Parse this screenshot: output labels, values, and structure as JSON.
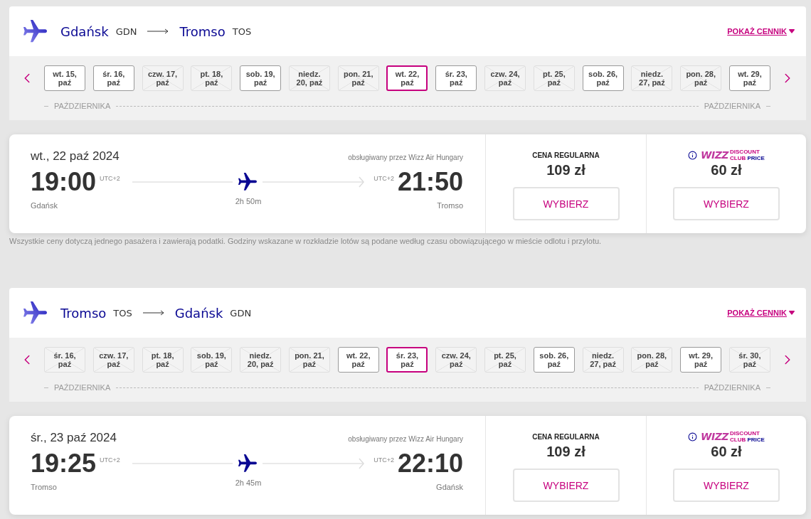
{
  "legs": [
    {
      "route": {
        "origin": {
          "city": "Gdańsk",
          "code": "GDN"
        },
        "destination": {
          "city": "Tromso",
          "code": "TOS"
        }
      },
      "price_link": {
        "label": "POKAŻ CENNIK"
      },
      "date_strip": {
        "dates": [
          {
            "line_1": "wt. 15,",
            "line_2": "paź",
            "available": true,
            "selected": false
          },
          {
            "line_1": "śr. 16,",
            "line_2": "paź",
            "available": true,
            "selected": false
          },
          {
            "line_1": "czw. 17,",
            "line_2": "paź",
            "available": false,
            "selected": false
          },
          {
            "line_1": "pt. 18,",
            "line_2": "paź",
            "available": false,
            "selected": false
          },
          {
            "line_1": "sob. 19,",
            "line_2": "paź",
            "available": true,
            "selected": false
          },
          {
            "line_1": "niedz.",
            "line_2": "20, paź",
            "available": false,
            "selected": false
          },
          {
            "line_1": "pon. 21,",
            "line_2": "paź",
            "available": false,
            "selected": false
          },
          {
            "line_1": "wt. 22,",
            "line_2": "paź",
            "available": true,
            "selected": true
          },
          {
            "line_1": "śr. 23,",
            "line_2": "paź",
            "available": true,
            "selected": false
          },
          {
            "line_1": "czw. 24,",
            "line_2": "paź",
            "available": false,
            "selected": false
          },
          {
            "line_1": "pt. 25,",
            "line_2": "paź",
            "available": false,
            "selected": false
          },
          {
            "line_1": "sob. 26,",
            "line_2": "paź",
            "available": true,
            "selected": false
          },
          {
            "line_1": "niedz.",
            "line_2": "27, paź",
            "available": false,
            "selected": false
          },
          {
            "line_1": "pon. 28,",
            "line_2": "paź",
            "available": false,
            "selected": false
          },
          {
            "line_1": "wt. 29,",
            "line_2": "paź",
            "available": true,
            "selected": false
          }
        ],
        "month_labels": [
          "PAŹDZIERNIKA",
          "PAŹDZIERNIKA"
        ]
      },
      "flight": {
        "date": "wt., 22 paź 2024",
        "operator": "obsługiwany przez Wizz Air Hungary",
        "departure": {
          "time": "19:00",
          "timezone": "UTC+2",
          "city": "Gdańsk"
        },
        "duration": "2h 50m",
        "arrival": {
          "time": "21:50",
          "timezone": "UTC+2",
          "city": "Tromso"
        },
        "fares": [
          {
            "kind": "regular",
            "label": "CENA REGULARNA",
            "price": "109 zł",
            "button": "WYBIERZ"
          },
          {
            "kind": "club",
            "wordmark": "WIZZ",
            "tagline_1": "DISCOUNT",
            "tagline_2": [
              "CLUB",
              "PRICE"
            ],
            "price": "60 zł",
            "button": "WYBIERZ"
          }
        ]
      },
      "disclaimer": "Wszystkie ceny dotyczą jednego pasażera i zawierają podatki. Godziny wskazane w rozkładzie lotów są podane według czasu obowiązującego w mieście odlotu i przylotu."
    },
    {
      "route": {
        "origin": {
          "city": "Tromso",
          "code": "TOS"
        },
        "destination": {
          "city": "Gdańsk",
          "code": "GDN"
        }
      },
      "price_link": {
        "label": "POKAŻ CENNIK"
      },
      "date_strip": {
        "dates": [
          {
            "line_1": "śr. 16,",
            "line_2": "paź",
            "available": false,
            "selected": false
          },
          {
            "line_1": "czw. 17,",
            "line_2": "paź",
            "available": false,
            "selected": false
          },
          {
            "line_1": "pt. 18,",
            "line_2": "paź",
            "available": false,
            "selected": false
          },
          {
            "line_1": "sob. 19,",
            "line_2": "paź",
            "available": false,
            "selected": false
          },
          {
            "line_1": "niedz.",
            "line_2": "20, paź",
            "available": false,
            "selected": false
          },
          {
            "line_1": "pon. 21,",
            "line_2": "paź",
            "available": false,
            "selected": false
          },
          {
            "line_1": "wt. 22,",
            "line_2": "paź",
            "available": true,
            "selected": false
          },
          {
            "line_1": "śr. 23,",
            "line_2": "paź",
            "available": true,
            "selected": true
          },
          {
            "line_1": "czw. 24,",
            "line_2": "paź",
            "available": false,
            "selected": false
          },
          {
            "line_1": "pt. 25,",
            "line_2": "paź",
            "available": false,
            "selected": false
          },
          {
            "line_1": "sob. 26,",
            "line_2": "paź",
            "available": true,
            "selected": false
          },
          {
            "line_1": "niedz.",
            "line_2": "27, paź",
            "available": false,
            "selected": false
          },
          {
            "line_1": "pon. 28,",
            "line_2": "paź",
            "available": false,
            "selected": false
          },
          {
            "line_1": "wt. 29,",
            "line_2": "paź",
            "available": true,
            "selected": false
          },
          {
            "line_1": "śr. 30,",
            "line_2": "paź",
            "available": false,
            "selected": false
          }
        ],
        "month_labels": [
          "PAŹDZIERNIKA",
          "PAŹDZIERNIKA"
        ]
      },
      "flight": {
        "date": "śr., 23 paź 2024",
        "operator": "obsługiwany przez Wizz Air Hungary",
        "departure": {
          "time": "19:25",
          "timezone": "UTC+2",
          "city": "Tromso"
        },
        "duration": "2h 45m",
        "arrival": {
          "time": "22:10",
          "timezone": "UTC+2",
          "city": "Gdańsk"
        },
        "fares": [
          {
            "kind": "regular",
            "label": "CENA REGULARNA",
            "price": "109 zł",
            "button": "WYBIERZ"
          },
          {
            "kind": "club",
            "wordmark": "WIZZ",
            "tagline_1": "DISCOUNT",
            "tagline_2": [
              "CLUB",
              "PRICE"
            ],
            "price": "60 zł",
            "button": "WYBIERZ"
          }
        ]
      }
    }
  ]
}
